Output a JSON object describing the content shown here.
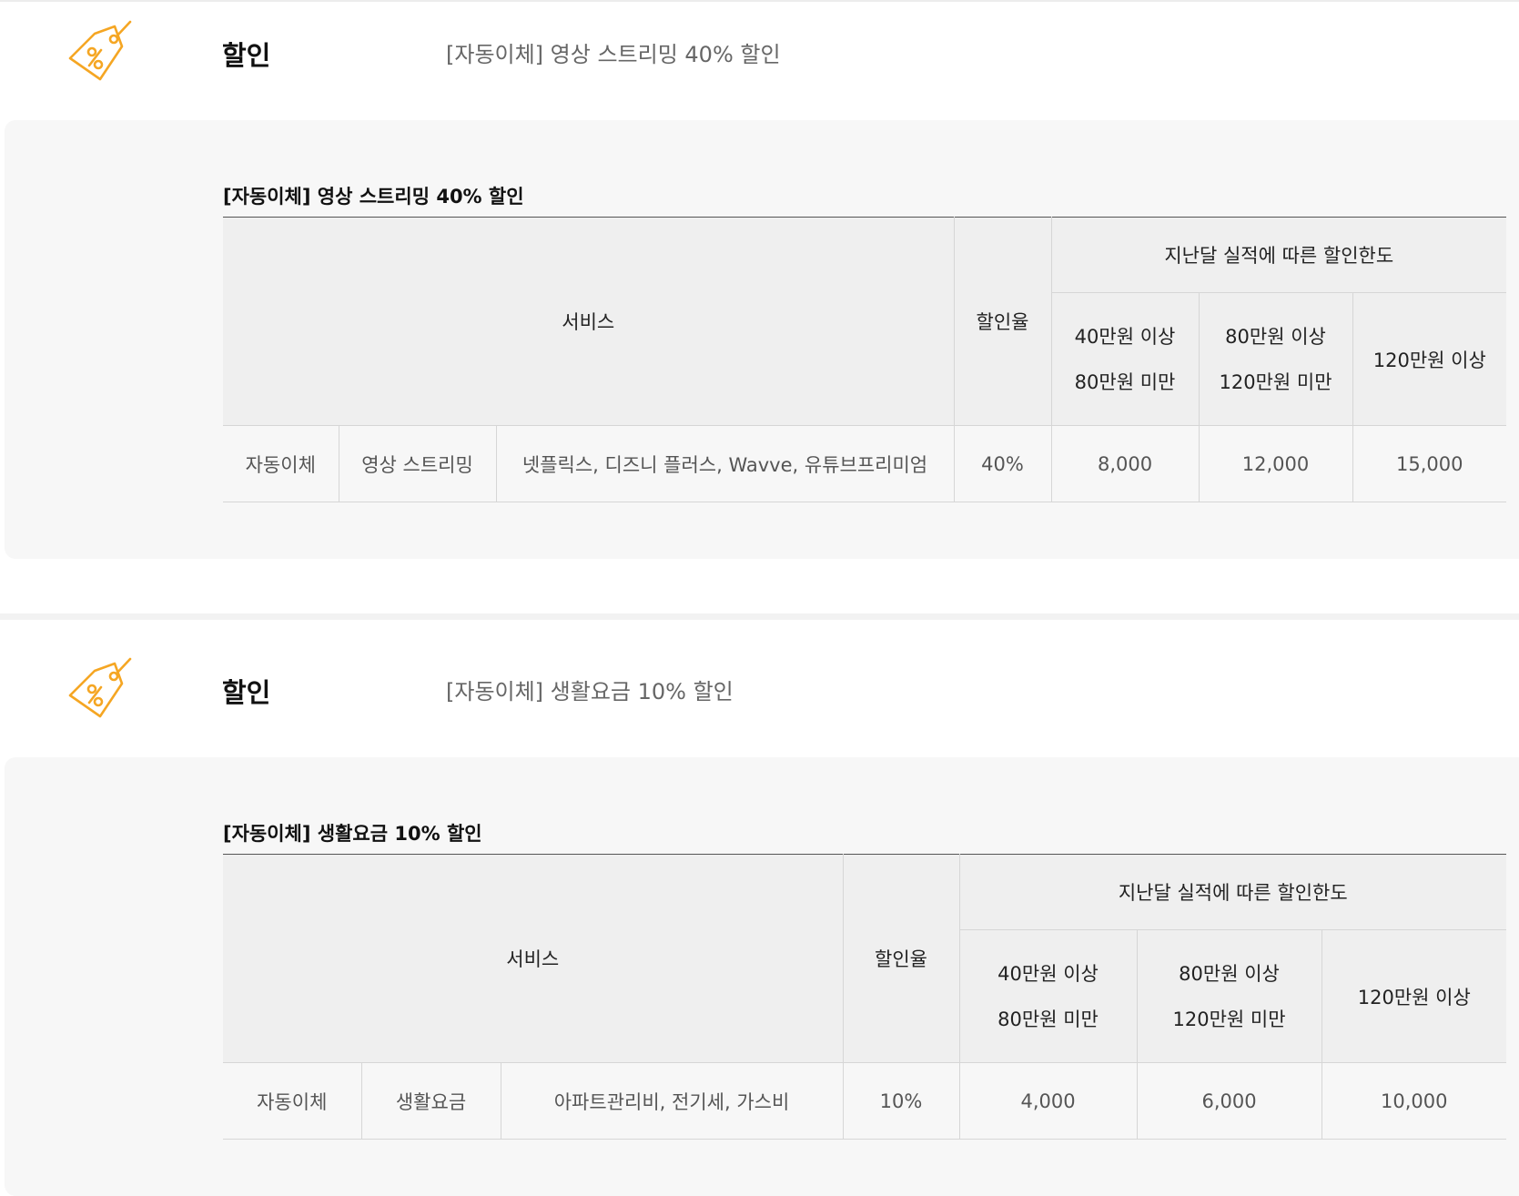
{
  "sections": [
    {
      "header": {
        "icon": "discount-tag-icon",
        "title": "할인",
        "description": "[자동이체] 영상 스트리밍 40% 할인"
      },
      "table_title": "[자동이체] 영상 스트리밍 40% 할인",
      "columns": {
        "service": "서비스",
        "rate": "할인율",
        "limit_group": "지난달 실적에 따른 할인한도",
        "tier1_line1": "40만원 이상",
        "tier1_line2": "80만원 미만",
        "tier2_line1": "80만원 이상",
        "tier2_line2": "120만원 미만",
        "tier3": "120만원 이상"
      },
      "row": {
        "type": "자동이체",
        "category": "영상 스트리밍",
        "merchants": "넷플릭스, 디즈니 플러스, Wavve, 유튜브프리미엄",
        "rate": "40%",
        "tier1": "8,000",
        "tier2": "12,000",
        "tier3": "15,000"
      }
    },
    {
      "header": {
        "icon": "discount-tag-icon",
        "title": "할인",
        "description": "[자동이체] 생활요금 10% 할인"
      },
      "table_title": "[자동이체] 생활요금 10% 할인",
      "columns": {
        "service": "서비스",
        "rate": "할인율",
        "limit_group": "지난달 실적에 따른 할인한도",
        "tier1_line1": "40만원 이상",
        "tier1_line2": "80만원 미만",
        "tier2_line1": "80만원 이상",
        "tier2_line2": "120만원 미만",
        "tier3": "120만원 이상"
      },
      "row": {
        "type": "자동이체",
        "category": "생활요금",
        "merchants": "아파트관리비, 전기세, 가스비",
        "rate": "10%",
        "tier1": "4,000",
        "tier2": "6,000",
        "tier3": "10,000"
      }
    }
  ],
  "colors": {
    "accent": "#f5a623",
    "panel": "#f7f7f7",
    "header_cell": "#efefef"
  }
}
